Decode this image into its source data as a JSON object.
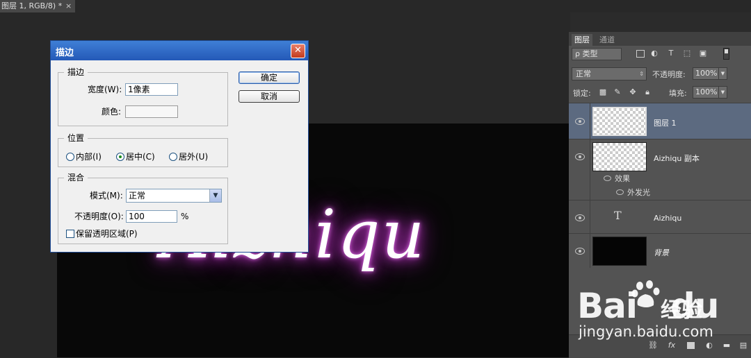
{
  "document": {
    "tab_title": "图层 1, RGB/8) *",
    "tab_close": "×",
    "canvas_text": "Aizhiqu"
  },
  "dialog": {
    "title": "描边",
    "close_glyph": "✕",
    "stroke_group": {
      "legend": "描边",
      "width_label": "宽度(W):",
      "width_value": "1像素",
      "color_label": "颜色:"
    },
    "position_group": {
      "legend": "位置",
      "options": [
        {
          "label": "内部(I)",
          "checked": false
        },
        {
          "label": "居中(C)",
          "checked": true
        },
        {
          "label": "居外(U)",
          "checked": false
        }
      ]
    },
    "blend_group": {
      "legend": "混合",
      "mode_label": "模式(M):",
      "mode_value": "正常",
      "opacity_label": "不透明度(O):",
      "opacity_value": "100",
      "opacity_unit": "%",
      "preserve_label": "保留透明区域(P)",
      "preserve_checked": false
    },
    "ok_label": "确定",
    "cancel_label": "取消"
  },
  "layers_panel": {
    "tabs": [
      {
        "label": "图层",
        "active": true
      },
      {
        "label": "通道",
        "active": false
      }
    ],
    "filter": {
      "kind_label": "ρ 类型",
      "icons": [
        "image-filter-icon",
        "adjustment-filter-icon",
        "type-filter-icon",
        "shape-filter-icon",
        "smart-object-filter-icon"
      ]
    },
    "blend_mode": "正常",
    "opacity_label": "不透明度:",
    "opacity_value": "100%",
    "lock_label": "锁定:",
    "fill_label": "填充:",
    "fill_value": "100%",
    "layers": [
      {
        "name": "图层 1",
        "type": "pixel",
        "selected": true
      },
      {
        "name": "Aizhiqu 副本",
        "type": "pixel",
        "selected": false,
        "effects_label": "效果",
        "effects": [
          "外发光"
        ]
      },
      {
        "name": "Aizhiqu",
        "type": "text",
        "selected": false
      },
      {
        "name": "背景",
        "type": "background",
        "selected": false
      }
    ],
    "bottom_icons": [
      "link-icon",
      "fx-icon",
      "mask-icon",
      "adjustment-icon",
      "folder-icon",
      "new-layer-icon"
    ]
  },
  "watermark": {
    "brand": "Bai du",
    "brand_left": "Bai",
    "brand_right": "du",
    "product": "经验",
    "url": "jingyan.baidu.com"
  }
}
